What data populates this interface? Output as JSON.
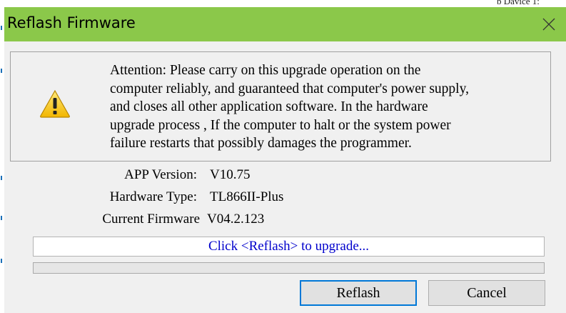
{
  "background": {
    "partial_text": "b  Davice 1:"
  },
  "dialog": {
    "title": "Reflash Firmware",
    "titlebar_color": "#8bc84a",
    "close_icon": "close-icon",
    "warning": {
      "icon": "warning-icon",
      "text": "Attention: Please  carry on this upgrade operation on the\ncomputer reliably, and guaranteed that computer's power supply,\nand closes all other application software. In the hardware\nupgrade process , If the computer to halt or the system power\nfailure restarts that possibly damages the programmer."
    },
    "info": [
      {
        "label": "APP Version:",
        "value": "V10.75"
      },
      {
        "label": "Hardware Type:",
        "value": "TL866II-Plus"
      },
      {
        "label": "Current Firmware",
        "value": "V04.2.123"
      }
    ],
    "status_text": "Click <Reflash> to upgrade...",
    "status_color": "#0000cc",
    "progress": 0,
    "buttons": {
      "reflash": "Reflash",
      "cancel": "Cancel"
    }
  }
}
